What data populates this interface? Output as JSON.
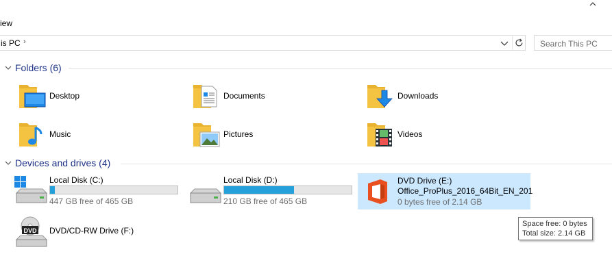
{
  "ribbon": {
    "tab_view": "iew"
  },
  "address": {
    "path": "is PC",
    "separator": "›"
  },
  "search": {
    "placeholder": "Search This PC"
  },
  "folders_group": {
    "title": "Folders (6)"
  },
  "folders": [
    {
      "label": "Desktop",
      "icon": "desktop-folder-icon"
    },
    {
      "label": "Documents",
      "icon": "documents-folder-icon"
    },
    {
      "label": "Downloads",
      "icon": "downloads-folder-icon"
    },
    {
      "label": "Music",
      "icon": "music-folder-icon"
    },
    {
      "label": "Pictures",
      "icon": "pictures-folder-icon"
    },
    {
      "label": "Videos",
      "icon": "videos-folder-icon"
    }
  ],
  "drives_group": {
    "title": "Devices and drives (4)"
  },
  "drives": [
    {
      "name": "Local Disk (C:)",
      "free_text": "447 GB free of 465 GB",
      "used_fraction": 0.04,
      "icon": "windows-disk-icon"
    },
    {
      "name": "Local Disk (D:)",
      "free_text": "210 GB free of 465 GB",
      "used_fraction": 0.55,
      "icon": "disk-icon"
    },
    {
      "name": "DVD Drive (E:)",
      "volume": "Office_ProPlus_2016_64Bit_EN_201",
      "free_text": "0 bytes free of 2.14 GB",
      "icon": "office-icon",
      "selected": true
    },
    {
      "name": "DVD/CD-RW Drive (F:)",
      "icon": "dvd-drive-icon",
      "badge": "DVD"
    }
  ],
  "tooltip": {
    "line1": "Space free: 0 bytes",
    "line2": "Total size: 2.14 GB"
  },
  "colors": {
    "accent": "#26a0da",
    "group_title": "#1e3287",
    "selection": "#cce8ff",
    "folder": "#f5c342",
    "office": "#e8511f"
  }
}
